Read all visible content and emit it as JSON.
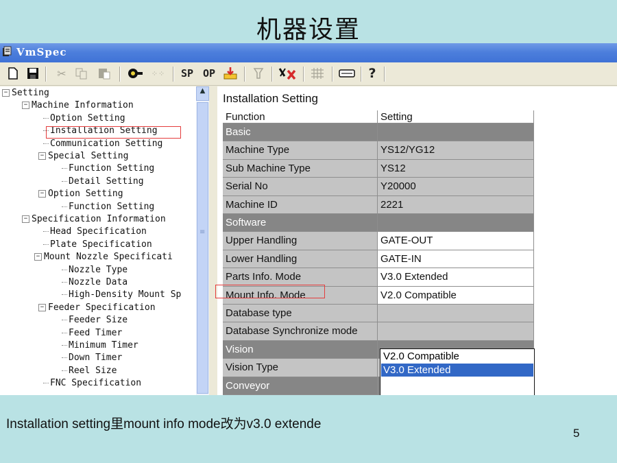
{
  "slide": {
    "title": "机器设置",
    "caption": "Installation setting里mount info mode改为v3.0 extende",
    "page_number": "5"
  },
  "window": {
    "title": "VmSpec",
    "icon": "app-icon"
  },
  "toolbar": {
    "sp_label": "SP",
    "op_label": "OP",
    "help_glyph": "?",
    "buttons": [
      "new-icon",
      "save-icon",
      "cut-icon",
      "copy-icon",
      "paste-icon",
      "machine-icon",
      "grid-dots-icon",
      "sp",
      "op",
      "download-icon",
      "filter-icon",
      "tool-delete-icon",
      "hatch-icon",
      "card-icon",
      "help-icon"
    ]
  },
  "tree": {
    "items": [
      {
        "label": "Setting",
        "expander": "−"
      },
      {
        "label": "Machine Information",
        "expander": "−"
      },
      {
        "label": "Option Setting"
      },
      {
        "label": "Installation Setting"
      },
      {
        "label": "Communication Setting"
      },
      {
        "label": "Special Setting",
        "expander": "−"
      },
      {
        "label": "Function Setting"
      },
      {
        "label": "Detail Setting"
      },
      {
        "label": "Option Setting",
        "expander": "−"
      },
      {
        "label": "Function Setting"
      },
      {
        "label": "Specification Information",
        "expander": "−"
      },
      {
        "label": "Head Specification"
      },
      {
        "label": "Plate Specification"
      },
      {
        "label": "Mount Nozzle Specificati",
        "expander": "−"
      },
      {
        "label": "Nozzle Type"
      },
      {
        "label": "Nozzle Data"
      },
      {
        "label": "High-Density Mount Sp"
      },
      {
        "label": "Feeder Specification",
        "expander": "−"
      },
      {
        "label": "Feeder Size"
      },
      {
        "label": "Feed Timer"
      },
      {
        "label": "Minimum Timer"
      },
      {
        "label": "Down Timer"
      },
      {
        "label": "Reel Size"
      },
      {
        "label": "FNC Specification"
      }
    ]
  },
  "panel": {
    "title": "Installation Setting",
    "columns": [
      "Function",
      "Setting"
    ],
    "rows": [
      {
        "label": "Basic",
        "value": ""
      },
      {
        "label": "Machine Type",
        "value": "YS12/YG12"
      },
      {
        "label": "Sub Machine Type",
        "value": "YS12"
      },
      {
        "label": "Serial No",
        "value": "Y20000"
      },
      {
        "label": "Machine ID",
        "value": "2221"
      },
      {
        "label": "Software",
        "value": ""
      },
      {
        "label": "Upper Handling",
        "value": "GATE-OUT"
      },
      {
        "label": "Lower Handling",
        "value": "GATE-IN"
      },
      {
        "label": "Parts Info. Mode",
        "value": "V3.0 Extended"
      },
      {
        "label": "Mount Info. Mode",
        "value": "V2.0 Compatible"
      },
      {
        "label": "Database type",
        "value": ""
      },
      {
        "label": "Database Synchronize mode",
        "value": ""
      },
      {
        "label": "Vision",
        "value": ""
      },
      {
        "label": "Vision Type",
        "value": ""
      },
      {
        "label": "Conveyor",
        "value": ""
      }
    ],
    "dropdown_options": [
      {
        "label": "V2.0 Compatible",
        "selected": false
      },
      {
        "label": "V3.0 Extended",
        "selected": true
      }
    ]
  },
  "colors": {
    "slide_background": "#b9e2e4",
    "titlebar": "#4d7fdc",
    "category_row": "#868686",
    "label_cell": "#c4c4c4",
    "highlight_box": "#e43c3c",
    "selection": "#3268c6"
  }
}
